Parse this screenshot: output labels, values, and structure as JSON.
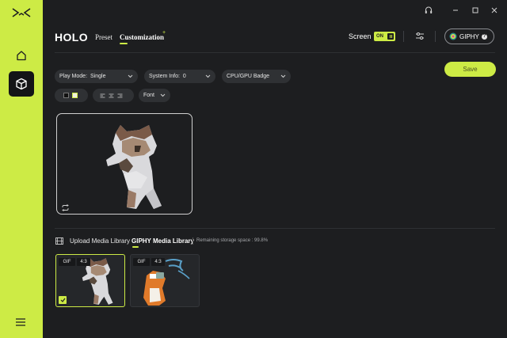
{
  "app": {
    "brand": "HOLO",
    "tabs": {
      "preset": "Preset",
      "customization": "Customization",
      "spark": "+"
    }
  },
  "header": {
    "screen_label": "Screen",
    "screen_toggle": "ON",
    "giphy_button": "GIPHY",
    "help_glyph": "?"
  },
  "toolbar": {
    "save_label": "Save",
    "play_mode": {
      "label": "Play Mode:",
      "value": "Single"
    },
    "system_info": {
      "label": "System Info:",
      "value": "0"
    },
    "gpu_badge": {
      "label": "CPU/GPU Badge"
    },
    "font": {
      "label": "Font"
    },
    "chevron": "⌵"
  },
  "library": {
    "upload_tab": "Upload Media Library",
    "giphy_tab": "GIPHY Media Library",
    "storage_text": "Remaining storage space : 99.8%"
  },
  "media": [
    {
      "format": "GIF",
      "ratio": "4:3",
      "selected": true
    },
    {
      "format": "GIF",
      "ratio": "4:3",
      "selected": false
    }
  ],
  "colors": {
    "accent": "#cdeb45",
    "background": "#1d1e20",
    "pill": "#2f3134"
  },
  "icons": [
    "app-logo-icon",
    "home-icon",
    "cube-icon",
    "hamburger-menu-icon",
    "headset-icon",
    "minimize-icon",
    "maximize-icon",
    "close-icon",
    "sliders-icon",
    "help-icon",
    "chevron-down-icon",
    "align-left-icon",
    "align-center-icon",
    "align-right-icon",
    "replay-icon",
    "media-library-icon",
    "check-icon"
  ]
}
